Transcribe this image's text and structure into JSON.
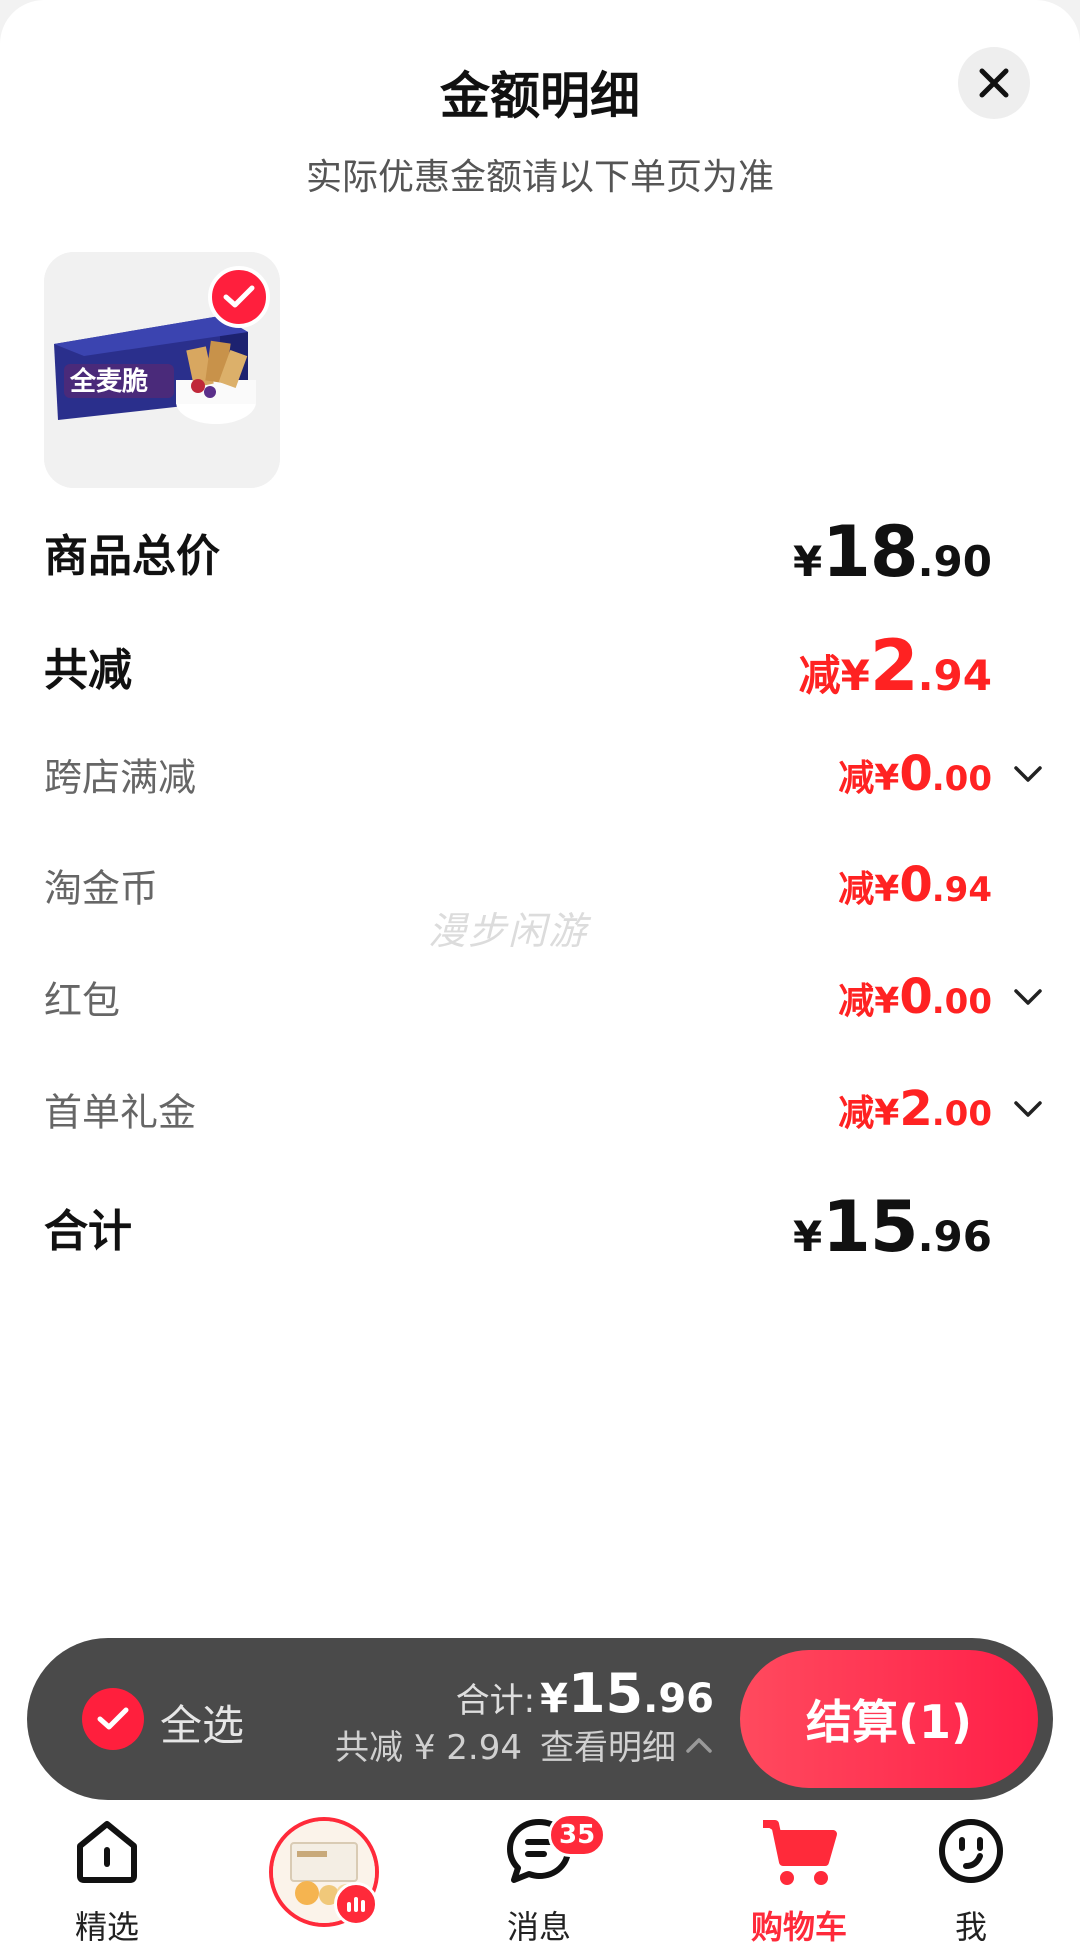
{
  "header": {
    "title": "金额明细",
    "subtitle": "实际优惠金额请以下单页为准"
  },
  "product": {
    "thumbnail": "全麦脆 biscuit box product image",
    "thumb_box_text": "全麦脆",
    "selected": true
  },
  "breakdown": {
    "goods_total": {
      "label": "商品总价",
      "symbol": "¥",
      "int": "18",
      "dec": ".90"
    },
    "total_discount": {
      "label": "共减",
      "prefix": "减¥",
      "int": "2",
      "dec": ".94"
    },
    "items": [
      {
        "label": "跨店满减",
        "prefix": "减¥",
        "int": "0",
        "dec": ".00",
        "expandable": true
      },
      {
        "label": "淘金币",
        "prefix": "减¥",
        "int": "0",
        "dec": ".94",
        "expandable": false
      },
      {
        "label": "红包",
        "prefix": "减¥",
        "int": "0",
        "dec": ".00",
        "expandable": true
      },
      {
        "label": "首单礼金",
        "prefix": "减¥",
        "int": "2",
        "dec": ".00",
        "expandable": true
      }
    ],
    "sum": {
      "label": "合计",
      "symbol": "¥",
      "int": "15",
      "dec": ".96"
    }
  },
  "watermark": "漫步闲游",
  "checkout_bar": {
    "select_all_label": "全选",
    "total_label": "合计:",
    "total_symbol": "¥",
    "total_int": "15",
    "total_dec": ".96",
    "discount_text": "共减 ¥ 2.94",
    "details_label": "查看明细",
    "checkout_label": "结算(1)"
  },
  "tabbar": {
    "items": [
      {
        "label": "精选",
        "icon": "home-icon",
        "active": false
      },
      {
        "label": "",
        "icon": "live-product-thumbnail",
        "active": false
      },
      {
        "label": "消息",
        "icon": "message-icon",
        "active": false,
        "badge": "35"
      },
      {
        "label": "购物车",
        "icon": "cart-icon",
        "active": true
      },
      {
        "label": "我",
        "icon": "smiley-icon",
        "active": false
      }
    ]
  },
  "colors": {
    "accent_red": "#ff2222",
    "checkout_gradient_start": "#ff4a5e",
    "checkout_gradient_end": "#ff1f48",
    "bar_background": "#4a4a4a"
  }
}
